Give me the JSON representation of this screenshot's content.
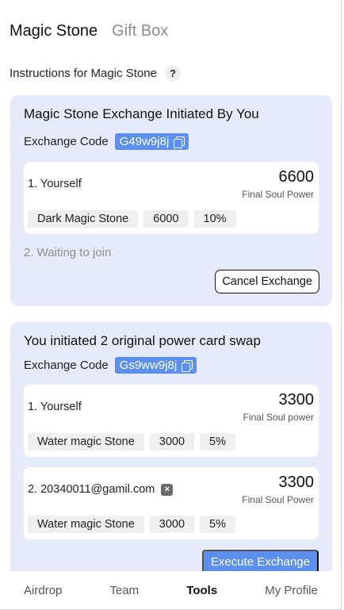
{
  "tabs": [
    {
      "label": "Magic Stone"
    },
    {
      "label": "Gift Box"
    }
  ],
  "instructions": {
    "label": "Instructions for Magic Stone",
    "help": "?"
  },
  "exchange1": {
    "title": "Magic Stone Exchange Initiated By You",
    "code_label": "Exchange Code",
    "code": "G49w9j8j",
    "players": [
      {
        "name": "1. Yourself",
        "power": "6600",
        "power_label": "Final Soul Power",
        "stone": "Dark Magic Stone",
        "amount": "6000",
        "percent": "10%"
      }
    ],
    "waiting": "2. Waiting to join",
    "cancel_label": "Cancel Exchange"
  },
  "exchange2": {
    "title": "You initiated 2 original power card swap",
    "code_label": "Exchange Code",
    "code": "Gs9ww9j8j",
    "players": [
      {
        "name": "1. Yourself",
        "power": "3300",
        "power_label": "Final Soul power",
        "stone": "Water magic Stone",
        "amount": "3000",
        "percent": "5%"
      },
      {
        "name": "2. 20340011@gamil.com",
        "power": "3300",
        "power_label": "Final Soul Power",
        "stone": "Water magic Stone",
        "amount": "3000",
        "percent": "5%",
        "remove": "×"
      }
    ],
    "execute_label": "Execute Exchange"
  },
  "nav": [
    {
      "label": "Airdrop"
    },
    {
      "label": "Team"
    },
    {
      "label": "Tools"
    },
    {
      "label": "My Profile"
    }
  ],
  "colors": {
    "accent": "#5b8ff0",
    "card_bg": "#e7eafb",
    "tag_bg": "#efefef"
  }
}
